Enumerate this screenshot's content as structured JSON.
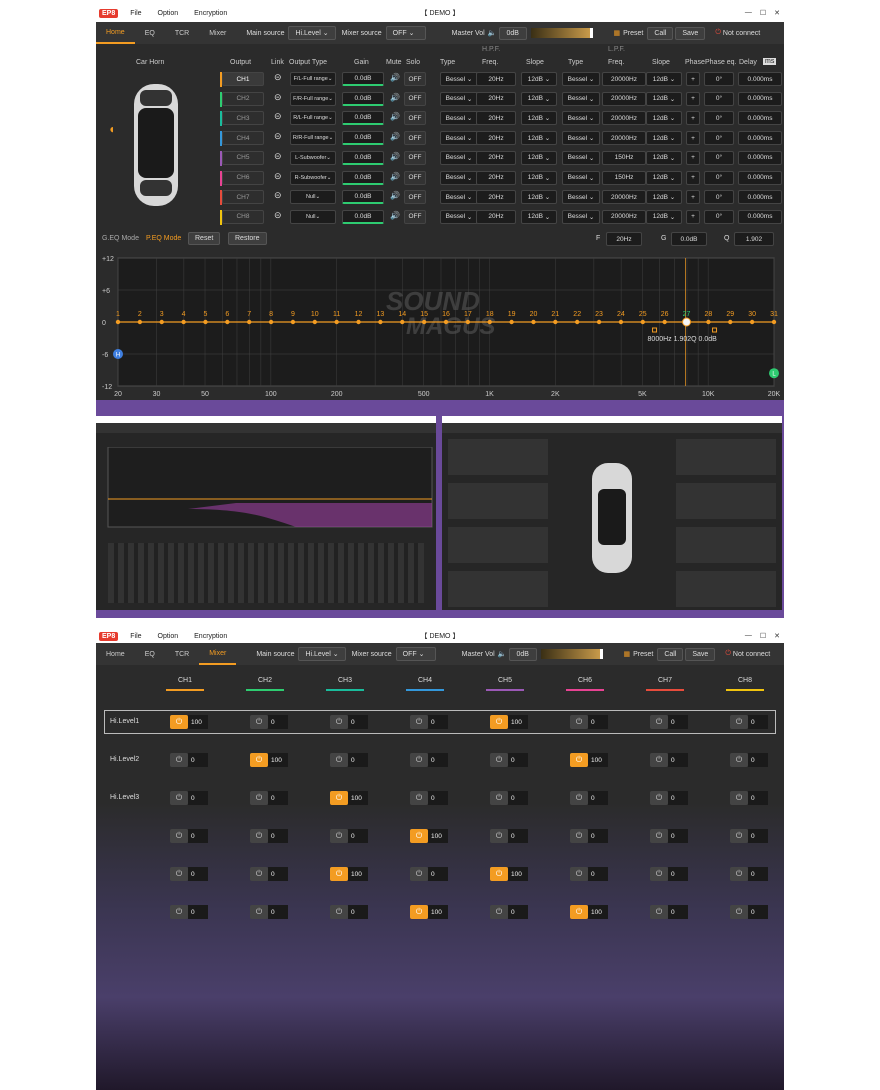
{
  "app": {
    "logo": "EP8",
    "menu": [
      "File",
      "Option",
      "Encryption"
    ],
    "title": "【 DEMO 】",
    "window_controls": [
      "—",
      "☐",
      "✕"
    ]
  },
  "toolbar": {
    "tabs": [
      "Home",
      "EQ",
      "TCR",
      "Mixer"
    ],
    "main_source_label": "Main source",
    "main_source_value": "Hi.Level",
    "mixer_source_label": "Mixer source",
    "mixer_source_value": "OFF",
    "master_vol_label": "Master Vol",
    "master_vol_value": "0dB",
    "preset_label": "Preset",
    "call_label": "Call",
    "save_label": "Save",
    "connection_status": "Not connect"
  },
  "home": {
    "car_label": "Car Horn",
    "columns": {
      "output": "Output",
      "link": "Link",
      "output_type": "Output Type",
      "gain": "Gain",
      "mute": "Mute",
      "solo": "Solo",
      "hpf": "H.P.F.",
      "lpf": "L.P.F.",
      "type": "Type",
      "freq": "Freq.",
      "slope": "Slope",
      "phase": "Phase",
      "phase_eq": "Phase eq.",
      "delay": "Delay",
      "delay_unit": "ms"
    },
    "channels": [
      {
        "name": "CH1",
        "type": "F/L-Full range",
        "gain": "0.0dB",
        "solo": "OFF",
        "hpf_type": "Bessel",
        "hpf_freq": "20Hz",
        "hpf_slope": "12dB",
        "lpf_type": "Bessel",
        "lpf_freq": "20000Hz",
        "lpf_slope": "12dB",
        "phase": "+",
        "phase_eq": "0°",
        "delay": "0.000ms",
        "color": "#f39c22"
      },
      {
        "name": "CH2",
        "type": "F/R-Full range",
        "gain": "0.0dB",
        "solo": "OFF",
        "hpf_type": "Bessel",
        "hpf_freq": "20Hz",
        "hpf_slope": "12dB",
        "lpf_type": "Bessel",
        "lpf_freq": "20000Hz",
        "lpf_slope": "12dB",
        "phase": "+",
        "phase_eq": "0°",
        "delay": "0.000ms",
        "color": "#2ecc71"
      },
      {
        "name": "CH3",
        "type": "R/L-Full range",
        "gain": "0.0dB",
        "solo": "OFF",
        "hpf_type": "Bessel",
        "hpf_freq": "20Hz",
        "hpf_slope": "12dB",
        "lpf_type": "Bessel",
        "lpf_freq": "20000Hz",
        "lpf_slope": "12dB",
        "phase": "+",
        "phase_eq": "0°",
        "delay": "0.000ms",
        "color": "#1abc9c"
      },
      {
        "name": "CH4",
        "type": "R/R-Full range",
        "gain": "0.0dB",
        "solo": "OFF",
        "hpf_type": "Bessel",
        "hpf_freq": "20Hz",
        "hpf_slope": "12dB",
        "lpf_type": "Bessel",
        "lpf_freq": "20000Hz",
        "lpf_slope": "12dB",
        "phase": "+",
        "phase_eq": "0°",
        "delay": "0.000ms",
        "color": "#3498db"
      },
      {
        "name": "CH5",
        "type": "L-Subwoofer",
        "gain": "0.0dB",
        "solo": "OFF",
        "hpf_type": "Bessel",
        "hpf_freq": "20Hz",
        "hpf_slope": "12dB",
        "lpf_type": "Bessel",
        "lpf_freq": "150Hz",
        "lpf_slope": "12dB",
        "phase": "+",
        "phase_eq": "0°",
        "delay": "0.000ms",
        "color": "#9b59b6"
      },
      {
        "name": "CH6",
        "type": "R-Subwoofer",
        "gain": "0.0dB",
        "solo": "OFF",
        "hpf_type": "Bessel",
        "hpf_freq": "20Hz",
        "hpf_slope": "12dB",
        "lpf_type": "Bessel",
        "lpf_freq": "150Hz",
        "lpf_slope": "12dB",
        "phase": "+",
        "phase_eq": "0°",
        "delay": "0.000ms",
        "color": "#e84393"
      },
      {
        "name": "CH7",
        "type": "Null",
        "gain": "0.0dB",
        "solo": "OFF",
        "hpf_type": "Bessel",
        "hpf_freq": "20Hz",
        "hpf_slope": "12dB",
        "lpf_type": "Bessel",
        "lpf_freq": "20000Hz",
        "lpf_slope": "12dB",
        "phase": "+",
        "phase_eq": "0°",
        "delay": "0.000ms",
        "color": "#e74c3c"
      },
      {
        "name": "CH8",
        "type": "Null",
        "gain": "0.0dB",
        "solo": "OFF",
        "hpf_type": "Bessel",
        "hpf_freq": "20Hz",
        "hpf_slope": "12dB",
        "lpf_type": "Bessel",
        "lpf_freq": "20000Hz",
        "lpf_slope": "12dB",
        "phase": "+",
        "phase_eq": "0°",
        "delay": "0.000ms",
        "color": "#f1c40f"
      }
    ],
    "eq_controls": {
      "geq_mode": "G.EQ Mode",
      "peq_mode": "P.EQ Mode",
      "reset": "Reset",
      "restore": "Restore",
      "f_label": "F",
      "f_value": "20Hz",
      "g_label": "G",
      "g_value": "0.0dB",
      "q_label": "Q",
      "q_value": "1.902"
    },
    "eq_graph": {
      "y_ticks": [
        "+12",
        "+6",
        "0",
        "-6",
        "-12"
      ],
      "x_ticks": [
        "20",
        "30",
        "50",
        "100",
        "200",
        "500",
        "1K",
        "2K",
        "5K",
        "10K",
        "20K"
      ],
      "band_numbers": [
        "1",
        "2",
        "3",
        "4",
        "5",
        "6",
        "7",
        "8",
        "9",
        "10",
        "11",
        "12",
        "13",
        "14",
        "15",
        "16",
        "17",
        "18",
        "19",
        "20",
        "21",
        "22",
        "23",
        "24",
        "25",
        "26",
        "27",
        "28",
        "29",
        "30",
        "31"
      ],
      "selected_band_readout": "8000Hz 1.902Q 0.0dB",
      "watermark_line1": "SOUND",
      "watermark_line2": "MAGUS",
      "hpf_marker": "H",
      "lpf_marker": "L"
    }
  },
  "mixer": {
    "channels": [
      "CH1",
      "CH2",
      "CH3",
      "CH4",
      "CH5",
      "CH6",
      "CH7",
      "CH8"
    ],
    "channel_colors": [
      "#f39c22",
      "#2ecc71",
      "#1abc9c",
      "#3498db",
      "#9b59b6",
      "#e84393",
      "#e74c3c",
      "#f1c40f"
    ],
    "rows": [
      {
        "label": "Hi.Level1",
        "values": [
          "100",
          "0",
          "0",
          "0",
          "100",
          "0",
          "0",
          "0"
        ],
        "on": [
          true,
          false,
          false,
          false,
          true,
          false,
          false,
          false
        ]
      },
      {
        "label": "Hi.Level2",
        "values": [
          "0",
          "100",
          "0",
          "0",
          "0",
          "100",
          "0",
          "0"
        ],
        "on": [
          false,
          true,
          false,
          false,
          false,
          true,
          false,
          false
        ]
      },
      {
        "label": "Hi.Level3",
        "values": [
          "0",
          "0",
          "100",
          "0",
          "0",
          "0",
          "0",
          "0"
        ],
        "on": [
          false,
          false,
          true,
          false,
          false,
          false,
          false,
          false
        ]
      },
      {
        "label": "",
        "values": [
          "0",
          "0",
          "0",
          "100",
          "0",
          "0",
          "0",
          "0"
        ],
        "on": [
          false,
          false,
          false,
          true,
          false,
          false,
          false,
          false
        ]
      },
      {
        "label": "",
        "values": [
          "0",
          "0",
          "100",
          "0",
          "100",
          "0",
          "0",
          "0"
        ],
        "on": [
          false,
          false,
          true,
          false,
          true,
          false,
          false,
          false
        ]
      },
      {
        "label": "",
        "values": [
          "0",
          "0",
          "0",
          "100",
          "0",
          "100",
          "0",
          "0"
        ],
        "on": [
          false,
          false,
          false,
          true,
          false,
          true,
          false,
          false
        ]
      }
    ]
  }
}
